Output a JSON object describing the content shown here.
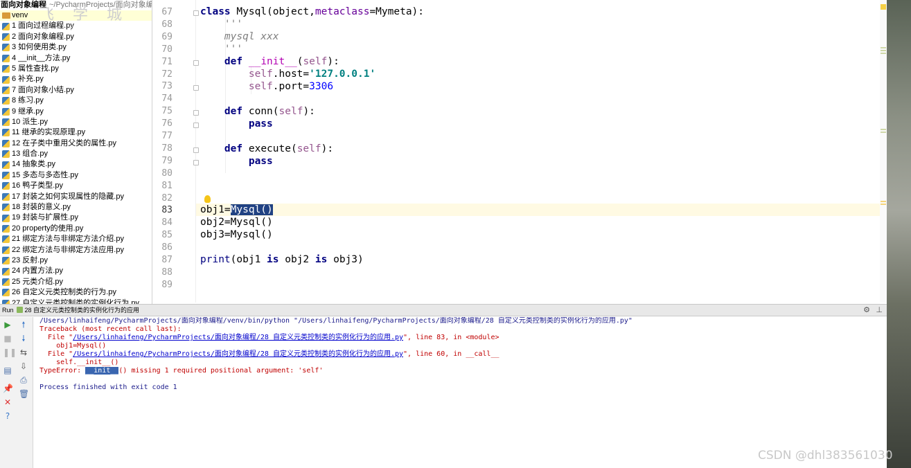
{
  "project": {
    "name": "面向对象编程",
    "path": "~/PycharmProjects/面向对象编",
    "watermark": "飞 学 城",
    "watermark_sub": "T Y",
    "venv": "venv",
    "files": [
      "1 面向过程编程.py",
      "2 面向对象编程.py",
      "3 如何使用类.py",
      "4 __init__方法.py",
      "5 属性查找.py",
      "6 补充.py",
      "7 面向对象小结.py",
      "8 练习.py",
      "9 继承.py",
      "10 派生.py",
      "11 继承的实现原理.py",
      "12 在子类中重用父类的属性.py",
      "13 组合.py",
      "14 抽象类.py",
      "15 多态与多态性.py",
      "16 鸭子类型.py",
      "17 封装之如何实现属性的隐藏.py",
      "18 封装的意义.py",
      "19 封装与扩展性.py",
      "20 property的使用.py",
      "21 绑定方法与非绑定方法介绍.py",
      "22 绑定方法与非绑定方法应用.py",
      "23 反射.py",
      "24 内置方法.py",
      "25 元类介绍.py",
      "26 自定义元类控制类的行为.py",
      "27 自定义元类控制类的实例化行为.py"
    ]
  },
  "editor": {
    "line_numbers": [
      "67",
      "68",
      "69",
      "70",
      "71",
      "72",
      "73",
      "74",
      "75",
      "76",
      "77",
      "78",
      "79",
      "80",
      "81",
      "82",
      "83",
      "84",
      "85",
      "86",
      "87",
      "88",
      "89"
    ],
    "current_line": "83",
    "selected_text": "Mysql()"
  },
  "run": {
    "tab_label": "Run",
    "config_name": "28 自定义元类控制类的实例化行为的应用",
    "console": {
      "command": "/Users/linhaifeng/PycharmProjects/面向对象编程/venv/bin/python \"/Users/linhaifeng/PycharmProjects/面向对象编程/28 自定义元类控制类的实例化行为的应用.py\"",
      "traceback_header": "Traceback (most recent call last):",
      "file1_prefix": "  File \"",
      "file1_link": "/Users/linhaifeng/PycharmProjects/面向对象编程/28 自定义元类控制类的实例化行为的应用.py",
      "file1_suffix": "\", line 83, in <module>",
      "file1_code": "    obj1=Mysql()",
      "file2_prefix": "  File \"",
      "file2_link": "/Users/linhaifeng/PycharmProjects/面向对象编程/28 自定义元类控制类的实例化行为的应用.py",
      "file2_suffix": "\", line 60, in __call__",
      "file2_code": "    self.__init__()",
      "error_prefix": "TypeError: ",
      "error_highlight": "__init__",
      "error_suffix": "() missing 1 required positional argument: 'self'",
      "exit": "Process finished with exit code 1"
    }
  },
  "watermark": "CSDN @dhl383561030",
  "colors": {
    "keyword": "#000080",
    "string": "#008080",
    "number": "#0000ff",
    "self": "#94558d",
    "selection": "#214283",
    "error": "#c00000"
  }
}
